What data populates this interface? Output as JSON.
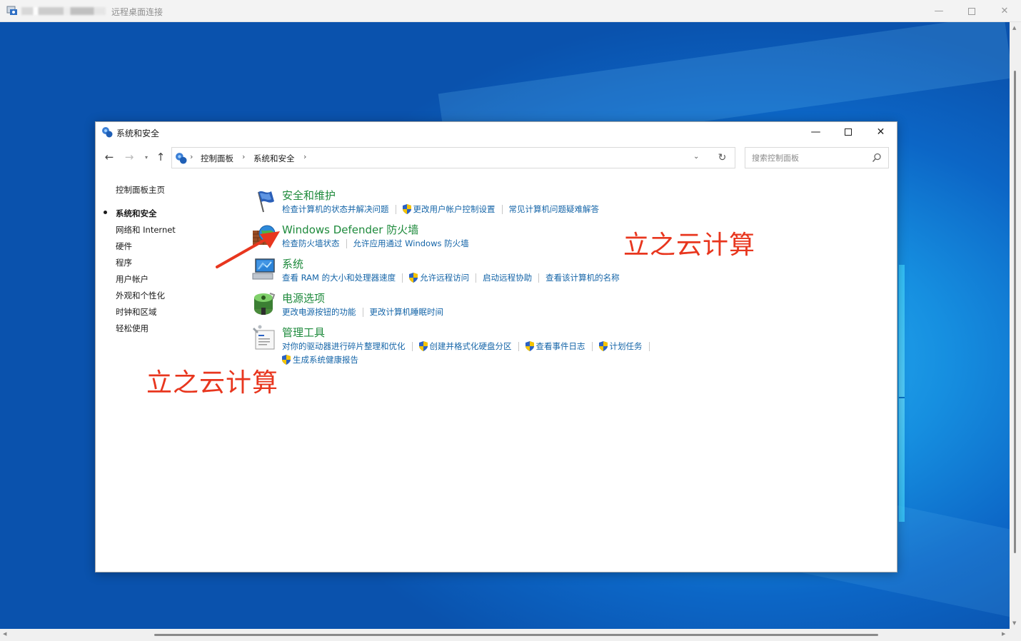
{
  "rdp": {
    "title": "远程桌面连接",
    "controls": {
      "minimize": "—",
      "close": "✕"
    }
  },
  "cp": {
    "title": "系统和安全",
    "controls": {
      "minimize": "—",
      "close": "✕"
    },
    "nav": {
      "back": "←",
      "forward": "→",
      "recent": "▾",
      "up": "↑"
    },
    "breadcrumbs": [
      "控制面板",
      "系统和安全"
    ],
    "crumb_separator": "›",
    "address_dropdown": "⌄",
    "refresh": "↻",
    "search": {
      "placeholder": "搜索控制面板"
    }
  },
  "sidebar": {
    "home": "控制面板主页",
    "items": [
      {
        "label": "系统和安全",
        "current": true
      },
      {
        "label": "网络和 Internet"
      },
      {
        "label": "硬件"
      },
      {
        "label": "程序"
      },
      {
        "label": "用户帐户"
      },
      {
        "label": "外观和个性化"
      },
      {
        "label": "时钟和区域"
      },
      {
        "label": "轻松使用"
      }
    ]
  },
  "sections": [
    {
      "icon": "flag-icon",
      "title": "安全和维护",
      "links": [
        {
          "label": "检查计算机的状态并解决问题"
        },
        {
          "label": "更改用户帐户控制设置",
          "shield": true
        },
        {
          "label": "常见计算机问题疑难解答"
        }
      ]
    },
    {
      "icon": "firewall-icon",
      "title": "Windows Defender 防火墙",
      "links": [
        {
          "label": "检查防火墙状态"
        },
        {
          "label": "允许应用通过 Windows 防火墙"
        }
      ]
    },
    {
      "icon": "system-icon",
      "title": "系统",
      "links": [
        {
          "label": "查看 RAM 的大小和处理器速度"
        },
        {
          "label": "允许远程访问",
          "shield": true
        },
        {
          "label": "启动远程协助"
        },
        {
          "label": "查看该计算机的名称"
        }
      ]
    },
    {
      "icon": "power-icon",
      "title": "电源选项",
      "links": [
        {
          "label": "更改电源按钮的功能"
        },
        {
          "label": "更改计算机睡眠时间"
        }
      ]
    },
    {
      "icon": "admin-tools-icon",
      "title": "管理工具",
      "links": [
        {
          "label": "对你的驱动器进行碎片整理和优化"
        },
        {
          "label": "创建并格式化硬盘分区",
          "shield": true
        },
        {
          "label": "查看事件日志",
          "shield": true
        },
        {
          "label": "计划任务",
          "shield": true
        }
      ],
      "links2": [
        {
          "label": "生成系统健康报告",
          "shield": true
        }
      ]
    }
  ],
  "watermarks": [
    "立之云计算",
    "立之云计算"
  ],
  "colors": {
    "section_title": "#1e8a3c",
    "link": "#1565a8",
    "watermark": "#e8361e",
    "desktop": "#0c66c6"
  }
}
